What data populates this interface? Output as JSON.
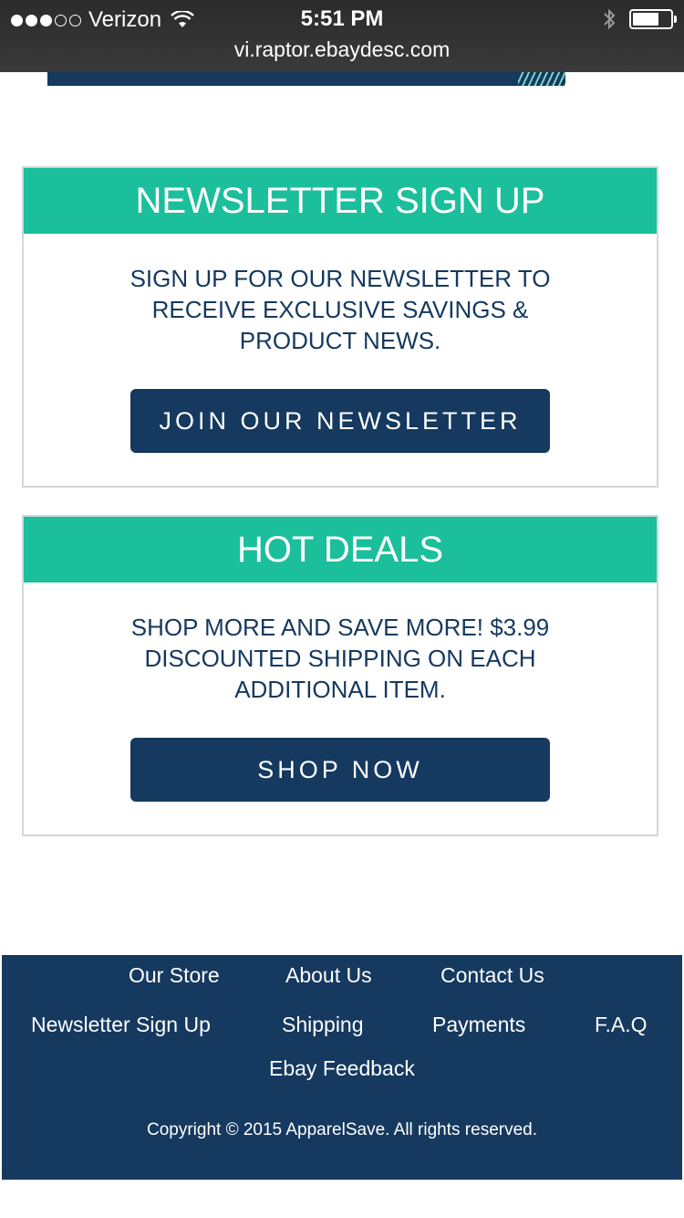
{
  "status_bar": {
    "carrier": "Verizon",
    "time": "5:51 PM",
    "url": "vi.raptor.ebaydesc.com",
    "signal_bars_filled": 3,
    "signal_bars_total": 5,
    "battery_level": 0.7
  },
  "newsletter": {
    "title": "NEWSLETTER SIGN UP",
    "text": "SIGN UP FOR OUR NEWSLETTER TO RECEIVE EXCLUSIVE SAVINGS & PRODUCT NEWS.",
    "button_label": "JOIN OUR NEWSLETTER"
  },
  "hot_deals": {
    "title": "HOT DEALS",
    "text": "SHOP MORE AND SAVE MORE! $3.99 DISCOUNTED SHIPPING ON EACH ADDITIONAL ITEM.",
    "button_label": "SHOP NOW"
  },
  "footer": {
    "links": {
      "our_store": "Our Store",
      "about_us": "About Us",
      "contact_us": "Contact Us",
      "newsletter_sign_up": "Newsletter Sign Up",
      "shipping": "Shipping",
      "payments": "Payments",
      "faq": "F.A.Q",
      "ebay_feedback": "Ebay Feedback"
    },
    "copyright": "Copyright © 2015 ApparelSave. All rights reserved."
  },
  "colors": {
    "accent_teal": "#1bbf9b",
    "navy": "#15395f",
    "status_bar": "#2b2b2b"
  }
}
